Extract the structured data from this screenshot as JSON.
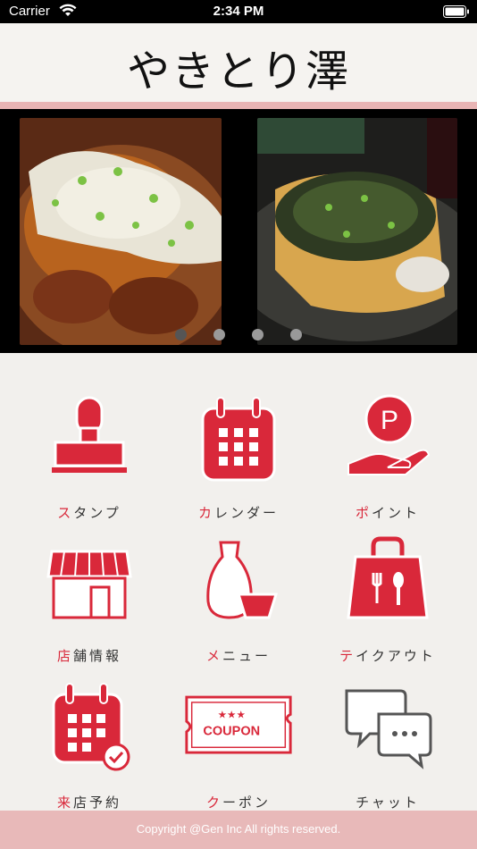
{
  "status_bar": {
    "carrier": "Carrier",
    "time": "2:34 PM"
  },
  "header": {
    "logo": "やきとり澤"
  },
  "carousel": {
    "slide_count": 4,
    "active_index": 0
  },
  "menu": [
    {
      "first": "ス",
      "rest": "タンプ",
      "icon": "stamp-icon"
    },
    {
      "first": "カ",
      "rest": "レンダー",
      "icon": "calendar-icon"
    },
    {
      "first": "ポ",
      "rest": "イント",
      "icon": "point-icon"
    },
    {
      "first": "店",
      "rest": "舗情報",
      "icon": "store-icon"
    },
    {
      "first": "メ",
      "rest": "ニュー",
      "icon": "sake-icon"
    },
    {
      "first": "テ",
      "rest": "イクアウト",
      "icon": "takeout-bag-icon"
    },
    {
      "first": "来",
      "rest": "店予約",
      "icon": "reservation-calendar-icon"
    },
    {
      "first": "ク",
      "rest": "ーポン",
      "icon": "coupon-icon"
    },
    {
      "first": "",
      "rest": "チャット",
      "icon": "chat-icon"
    }
  ],
  "coupon_text": "COUPON",
  "point_letter": "P",
  "footer": {
    "copyright": "Copyright @Gen Inc All rights reserved."
  },
  "colors": {
    "accent": "#d9283a",
    "footer": "#e8b9b9",
    "pink_line": "#e8b4b4"
  }
}
